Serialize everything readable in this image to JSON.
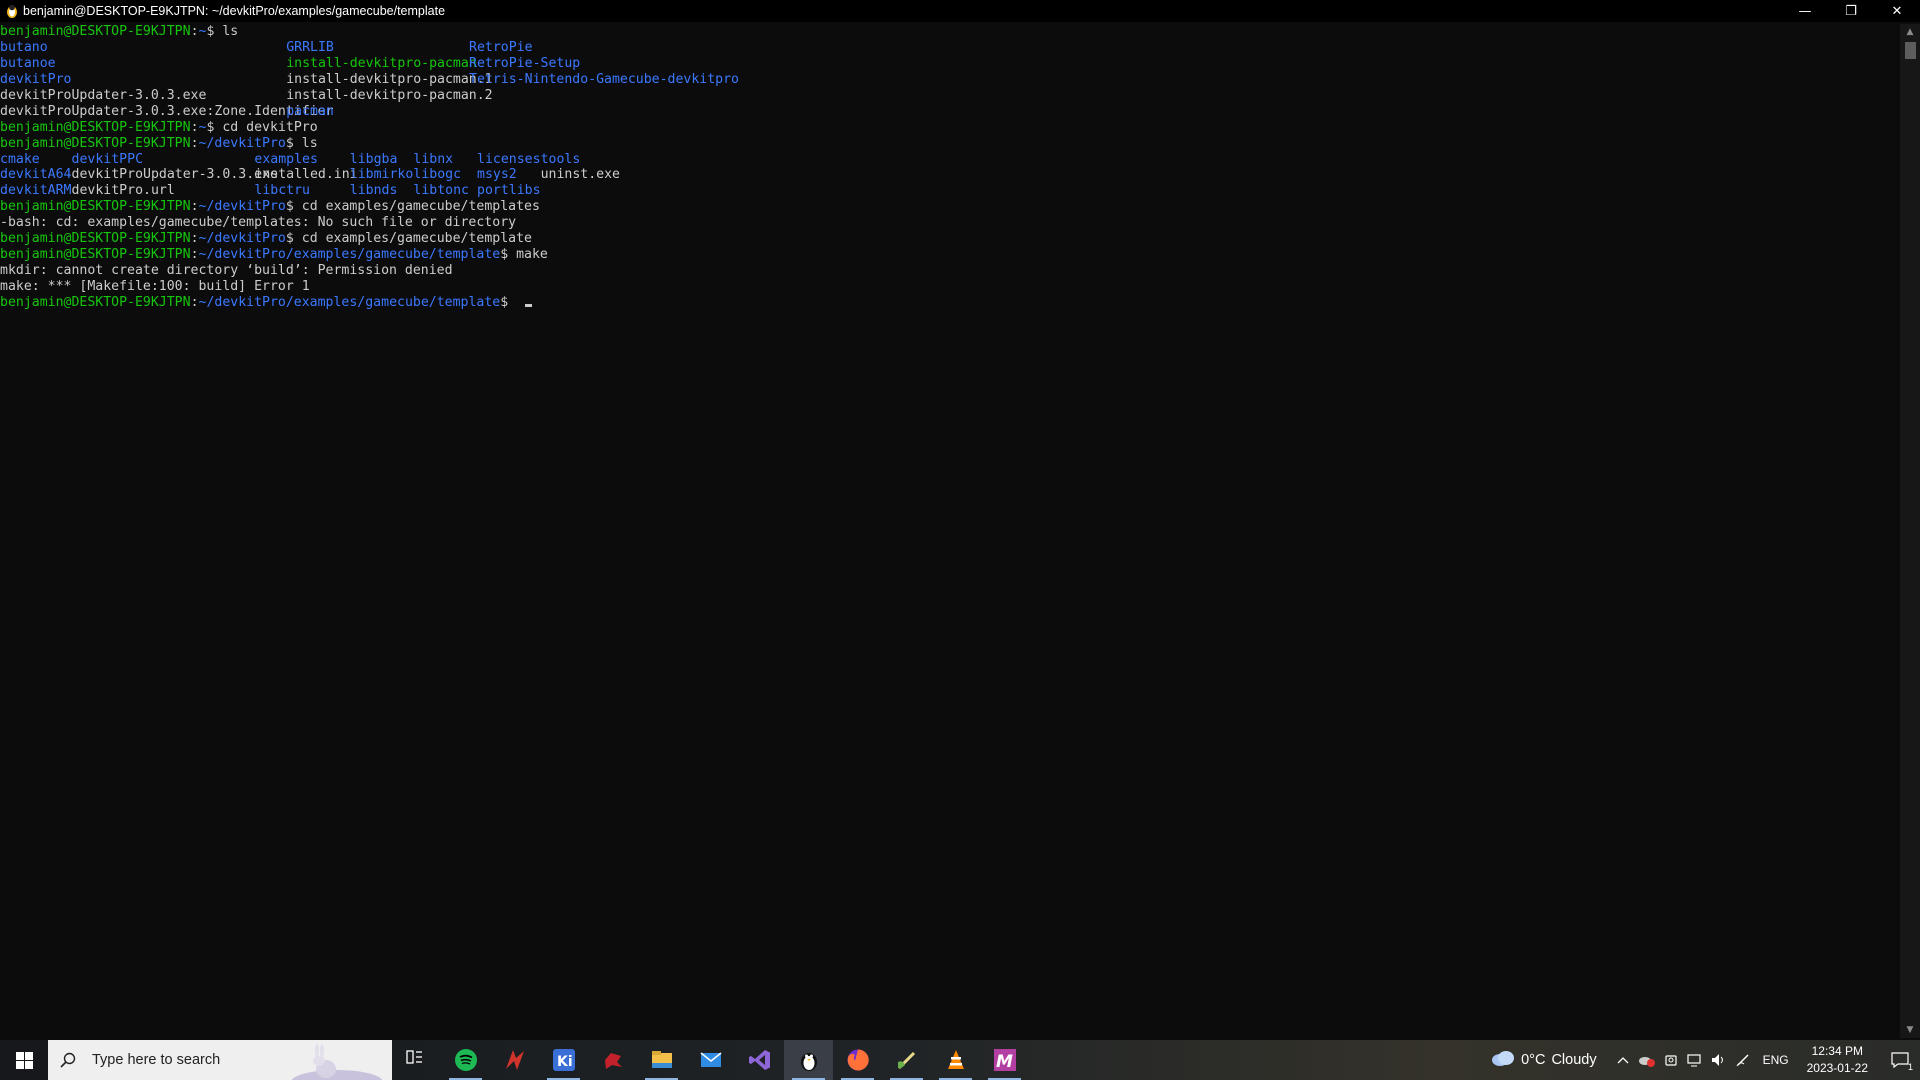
{
  "window": {
    "title": "benjamin@DESKTOP-E9KJTPN: ~/devkitPro/examples/gamecube/template",
    "controls": {
      "minimize": "—",
      "restore": "❐",
      "close": "✕"
    }
  },
  "terminal": {
    "lines": [
      {
        "user": "benjamin@DESKTOP-E9KJTPN",
        "path": "~",
        "cmd": " ls"
      },
      {
        "cols": [
          [
            "butano",
            "dir"
          ],
          [
            "GRRLIB",
            "dir"
          ],
          [
            "RetroPie",
            "dir"
          ]
        ]
      },
      {
        "cols": [
          [
            "butanoe",
            "dir"
          ],
          [
            "install-devkitpro-pacman",
            "exec"
          ],
          [
            "RetroPie-Setup",
            "dir"
          ]
        ]
      },
      {
        "cols": [
          [
            "devkitPro",
            "dir"
          ],
          [
            "install-devkitpro-pacman.1",
            "plain"
          ],
          [
            "Tetris-Nintendo-Gamecube-devkitpro",
            "dir"
          ]
        ]
      },
      {
        "cols": [
          [
            "devkitProUpdater-3.0.3.exe",
            "plain"
          ],
          [
            "install-devkitpro-pacman.2",
            "plain"
          ],
          [
            "",
            ""
          ]
        ]
      },
      {
        "cols": [
          [
            "devkitProUpdater-3.0.3.exe:Zone.Identifier",
            "plain"
          ],
          [
            "pacman",
            "dir"
          ],
          [
            "",
            ""
          ]
        ]
      },
      {
        "user": "benjamin@DESKTOP-E9KJTPN",
        "path": "~",
        "cmd": " cd devkitPro"
      },
      {
        "user": "benjamin@DESKTOP-E9KJTPN",
        "path": "~/devkitPro",
        "cmd": " ls"
      },
      {
        "grid": [
          [
            "cmake",
            "dir"
          ],
          [
            "devkitPPC",
            "dir"
          ],
          [
            "examples",
            "dir"
          ],
          [
            "libgba",
            "dir"
          ],
          [
            "libnx",
            "dir"
          ],
          [
            "licenses",
            "dir"
          ],
          [
            "tools",
            "dir"
          ]
        ]
      },
      {
        "grid": [
          [
            "devkitA64",
            "dir"
          ],
          [
            "devkitProUpdater-3.0.3.exe",
            "plain"
          ],
          [
            "installed.ini",
            "plain"
          ],
          [
            "libmirko",
            "dir"
          ],
          [
            "libogc",
            "dir"
          ],
          [
            "msys2",
            "dir"
          ],
          [
            "uninst.exe",
            "plain"
          ]
        ]
      },
      {
        "grid": [
          [
            "devkitARM",
            "dir"
          ],
          [
            "devkitPro.url",
            "plain"
          ],
          [
            "libctru",
            "dir"
          ],
          [
            "libnds",
            "dir"
          ],
          [
            "libtonc",
            "dir"
          ],
          [
            "portlibs",
            "dir"
          ],
          [
            "",
            ""
          ]
        ]
      },
      {
        "user": "benjamin@DESKTOP-E9KJTPN",
        "path": "~/devkitPro",
        "cmd": " cd examples/gamecube/templates"
      },
      {
        "text": "-bash: cd: examples/gamecube/templates: No such file or directory"
      },
      {
        "user": "benjamin@DESKTOP-E9KJTPN",
        "path": "~/devkitPro",
        "cmd": " cd examples/gamecube/template"
      },
      {
        "user": "benjamin@DESKTOP-E9KJTPN",
        "path": "~/devkitPro/examples/gamecube/template",
        "cmd": " make"
      },
      {
        "text": "mkdir: cannot create directory ‘build’: Permission denied"
      },
      {
        "text": "make: *** [Makefile:100: build] Error 1"
      },
      {
        "user": "benjamin@DESKTOP-E9KJTPN",
        "path": "~/devkitPro/examples/gamecube/template",
        "cmd": " ",
        "cursor": true
      }
    ]
  },
  "taskbar": {
    "search_placeholder": "Type here to search",
    "apps": [
      {
        "name": "task-view",
        "color": "#ffffff"
      },
      {
        "name": "spotify",
        "color": "#1db954"
      },
      {
        "name": "app-red-arrow",
        "color": "#d0342c"
      },
      {
        "name": "krita",
        "color": "#3b6fd8"
      },
      {
        "name": "app-red-bug",
        "color": "#c4222a"
      },
      {
        "name": "file-explorer",
        "color": "#f3c04b"
      },
      {
        "name": "mail",
        "color": "#2e8ce6"
      },
      {
        "name": "visual-studio",
        "color": "#8f66d8"
      },
      {
        "name": "wsl-terminal",
        "color": "#ffffff"
      },
      {
        "name": "firefox",
        "color": "#ff7139"
      },
      {
        "name": "app-brush",
        "color": "#e9d98a"
      },
      {
        "name": "vlc",
        "color": "#ff8800"
      },
      {
        "name": "app-m",
        "color": "#b43fa3"
      }
    ],
    "weather": {
      "temp": "0°C",
      "condition": "Cloudy"
    },
    "language": "ENG",
    "time": "12:34 PM",
    "date": "2023-01-22",
    "notification_count": "1"
  }
}
